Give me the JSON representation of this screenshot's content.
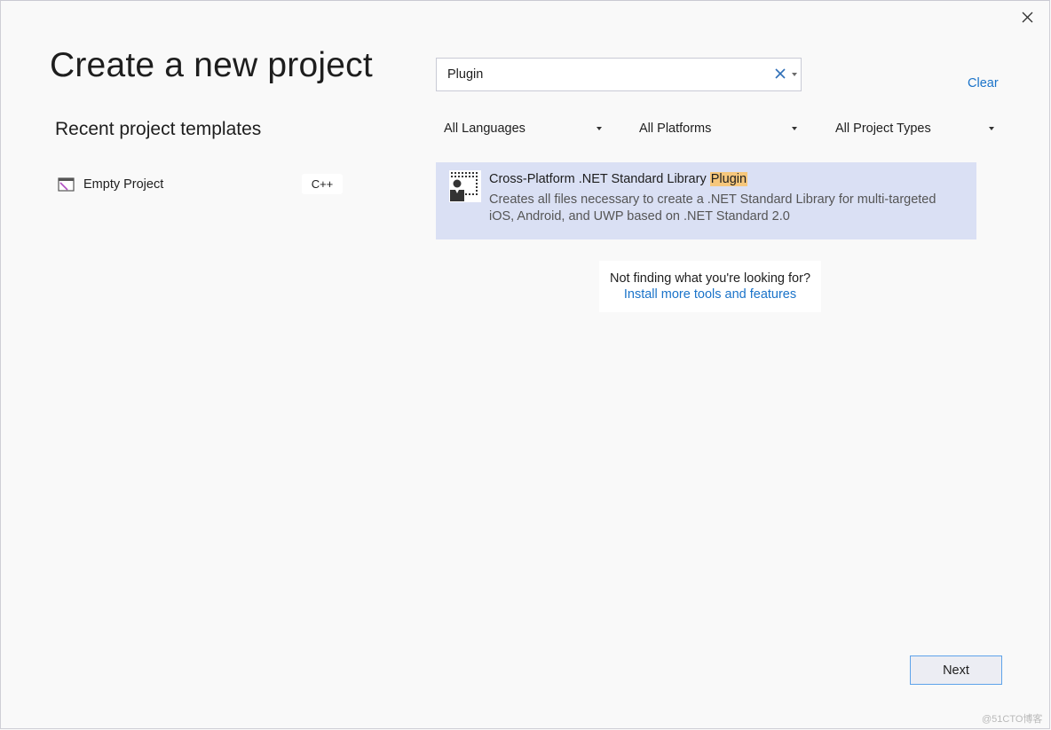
{
  "window": {
    "title": "Create a new project",
    "close_icon": "close-icon"
  },
  "recent": {
    "title": "Recent project templates",
    "items": [
      {
        "label": "Empty Project",
        "language": "C++",
        "icon": "empty-project-icon"
      }
    ]
  },
  "search": {
    "value": "Plugin",
    "placeholder": "Search for templates",
    "clear_icon": "clear-x-icon",
    "dropdown_icon": "chevron-down-icon"
  },
  "clear_label": "Clear",
  "filters": [
    {
      "label": "All Languages"
    },
    {
      "label": "All Platforms"
    },
    {
      "label": "All Project Types"
    }
  ],
  "results": [
    {
      "name_prefix": "Cross-Platform .NET Standard Library ",
      "name_highlight": "Plugin",
      "description": "Creates all files necessary to create a .NET Standard Library for multi-targeted iOS, Android, and UWP based on .NET Standard 2.0",
      "icon": "plugin-template-icon",
      "highlight_color": "#f6c77c",
      "selected_bg": "#dae0f4"
    }
  ],
  "not_finding": {
    "question": "Not finding what you're looking for?",
    "link": "Install more tools and features"
  },
  "footer": {
    "next_label": "Next"
  },
  "watermark": "@51CTO博客",
  "colors": {
    "link": "#1a73c9",
    "accent_border": "#5ea3ea"
  }
}
